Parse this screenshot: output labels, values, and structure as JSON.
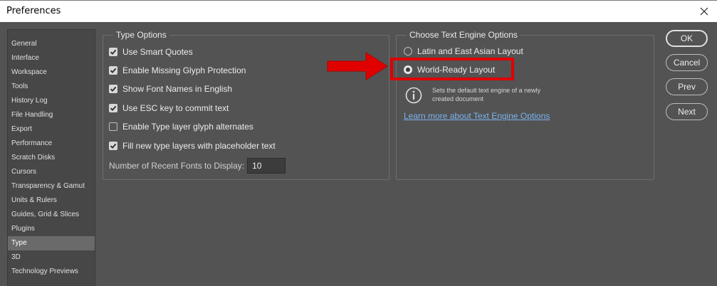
{
  "window": {
    "title": "Preferences"
  },
  "sidebar": {
    "items": [
      {
        "label": "General"
      },
      {
        "label": "Interface"
      },
      {
        "label": "Workspace"
      },
      {
        "label": "Tools"
      },
      {
        "label": "History Log"
      },
      {
        "label": "File Handling"
      },
      {
        "label": "Export"
      },
      {
        "label": "Performance"
      },
      {
        "label": "Scratch Disks"
      },
      {
        "label": "Cursors"
      },
      {
        "label": "Transparency & Gamut"
      },
      {
        "label": "Units & Rulers"
      },
      {
        "label": "Guides, Grid & Slices"
      },
      {
        "label": "Plugins"
      },
      {
        "label": "Type",
        "selected": true
      },
      {
        "label": "3D"
      },
      {
        "label": "Technology Previews"
      }
    ]
  },
  "type_options": {
    "title": "Type Options",
    "checkboxes": [
      {
        "label": "Use Smart Quotes",
        "checked": true
      },
      {
        "label": "Enable Missing Glyph Protection",
        "checked": true
      },
      {
        "label": "Show Font Names in English",
        "checked": true
      },
      {
        "label": "Use ESC key to commit text",
        "checked": true
      },
      {
        "label": "Enable Type layer glyph alternates",
        "checked": false
      },
      {
        "label": "Fill new type layers with placeholder text",
        "checked": true
      }
    ],
    "recent_fonts_label": "Number of Recent Fonts to Display:",
    "recent_fonts_value": "10"
  },
  "text_engine": {
    "title": "Choose Text Engine Options",
    "options": [
      {
        "label": "Latin and East Asian Layout",
        "selected": false
      },
      {
        "label": "World-Ready Layout",
        "selected": true
      }
    ],
    "info_line1": "Sets the default text engine of a newly",
    "info_line2": "created document",
    "learn_more": "Learn more about Text Engine Options"
  },
  "buttons": {
    "ok": "OK",
    "cancel": "Cancel",
    "prev": "Prev",
    "next": "Next"
  },
  "colors": {
    "background": "#535353",
    "sidebar": "#474747",
    "link": "#7ab3ee",
    "annotation": "#e00000"
  },
  "icons": {
    "close": "close-icon",
    "info": "info-icon",
    "checkmark": "checkmark-icon",
    "arrow": "arrow-icon"
  }
}
